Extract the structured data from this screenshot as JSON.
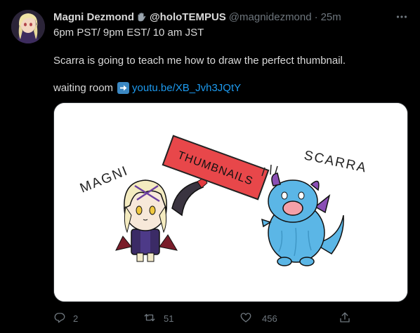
{
  "tweet": {
    "display_name": "Magni Dezmond",
    "display_name_2": "@holoTEMPUS",
    "handle": "@magnidezmond",
    "separator": "·",
    "time": "25m",
    "line1": "6pm PST/ 9pm EST/ 10 am JST",
    "line2": "Scarra is going to teach me how to draw the perfect thumbnail.",
    "line3_prefix": "waiting room",
    "link": "youtu.be/XB_Jvh3JQtY"
  },
  "media": {
    "label_left": "MAGNI",
    "sign_text": "THUMBNAILS",
    "label_right": "SCARRA"
  },
  "actions": {
    "reply_count": "2",
    "retweet_count": "51",
    "like_count": "456"
  },
  "colors": {
    "background": "#000000",
    "text": "#d9d9d9",
    "muted": "#6e767d",
    "link": "#1d9bf0",
    "sign_red": "#e8474a",
    "dragon_blue": "#5bb6e6",
    "dragon_purple": "#8a4fb5"
  },
  "icons": [
    "gauntlet-emoji-icon",
    "more-icon",
    "arrow-right-emoji-icon",
    "reply-icon",
    "retweet-icon",
    "like-icon",
    "share-icon"
  ]
}
